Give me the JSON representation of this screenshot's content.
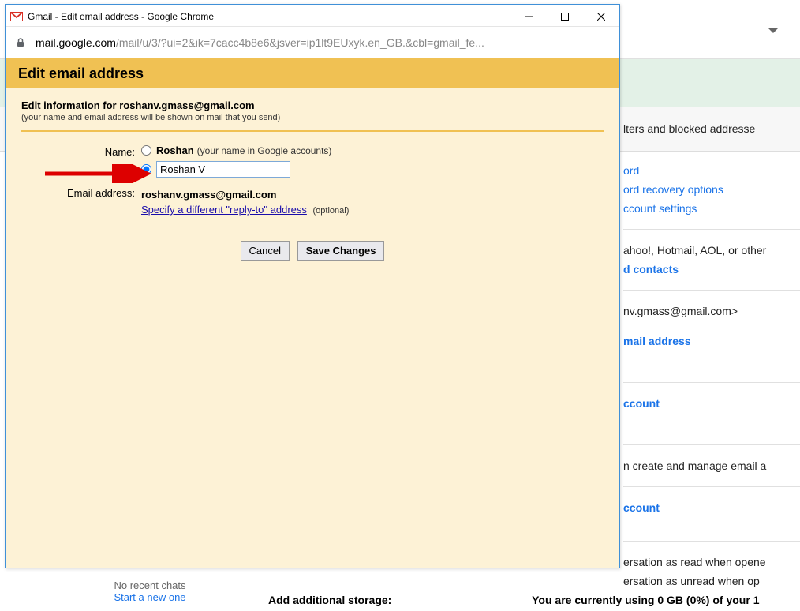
{
  "bg": {
    "tabs_text": "lters and blocked addresse",
    "links": {
      "password": "ord",
      "recovery": "ord recovery options",
      "account_settings": "ccount settings",
      "mail_contacts": "d contacts",
      "mail_address": "mail address",
      "account1": "ccount",
      "account2": "ccount"
    },
    "text": {
      "other_providers": "ahoo!, Hotmail, AOL, or other",
      "email_display": "nv.gmass@gmail.com>",
      "create_manage": "n create and manage email a",
      "read_open": "ersation as read when opene",
      "unread_open": "ersation as unread when op"
    },
    "left_panel": {
      "no_chats": "No recent chats",
      "start_new": "Start a new one"
    },
    "bottom": {
      "add_storage_label": "Add additional storage:",
      "storage_info": "You are currently using 0 GB (0%) of your 1"
    }
  },
  "popup": {
    "title": "Gmail - Edit email address - Google Chrome",
    "url_dark": "mail.google.com",
    "url_light": "/mail/u/3/?ui=2&ik=7cacc4b8e6&jsver=ip1lt9EUxyk.en_GB.&cbl=gmail_fe..."
  },
  "dialog": {
    "header": "Edit email address",
    "edit_info_title": "Edit information for roshanv.gmass@gmail.com",
    "edit_info_sub": "(your name and email address will be shown on mail that you send)",
    "name_label": "Name:",
    "radio1_label": "Roshan",
    "radio1_sub": "(your name in Google accounts)",
    "name_input_value": "Roshan V",
    "email_label": "Email address:",
    "email_value": "roshanv.gmass@gmail.com",
    "specify_link": "Specify a different \"reply-to\" address",
    "optional": "(optional)",
    "cancel_btn": "Cancel",
    "save_btn": "Save Changes"
  }
}
